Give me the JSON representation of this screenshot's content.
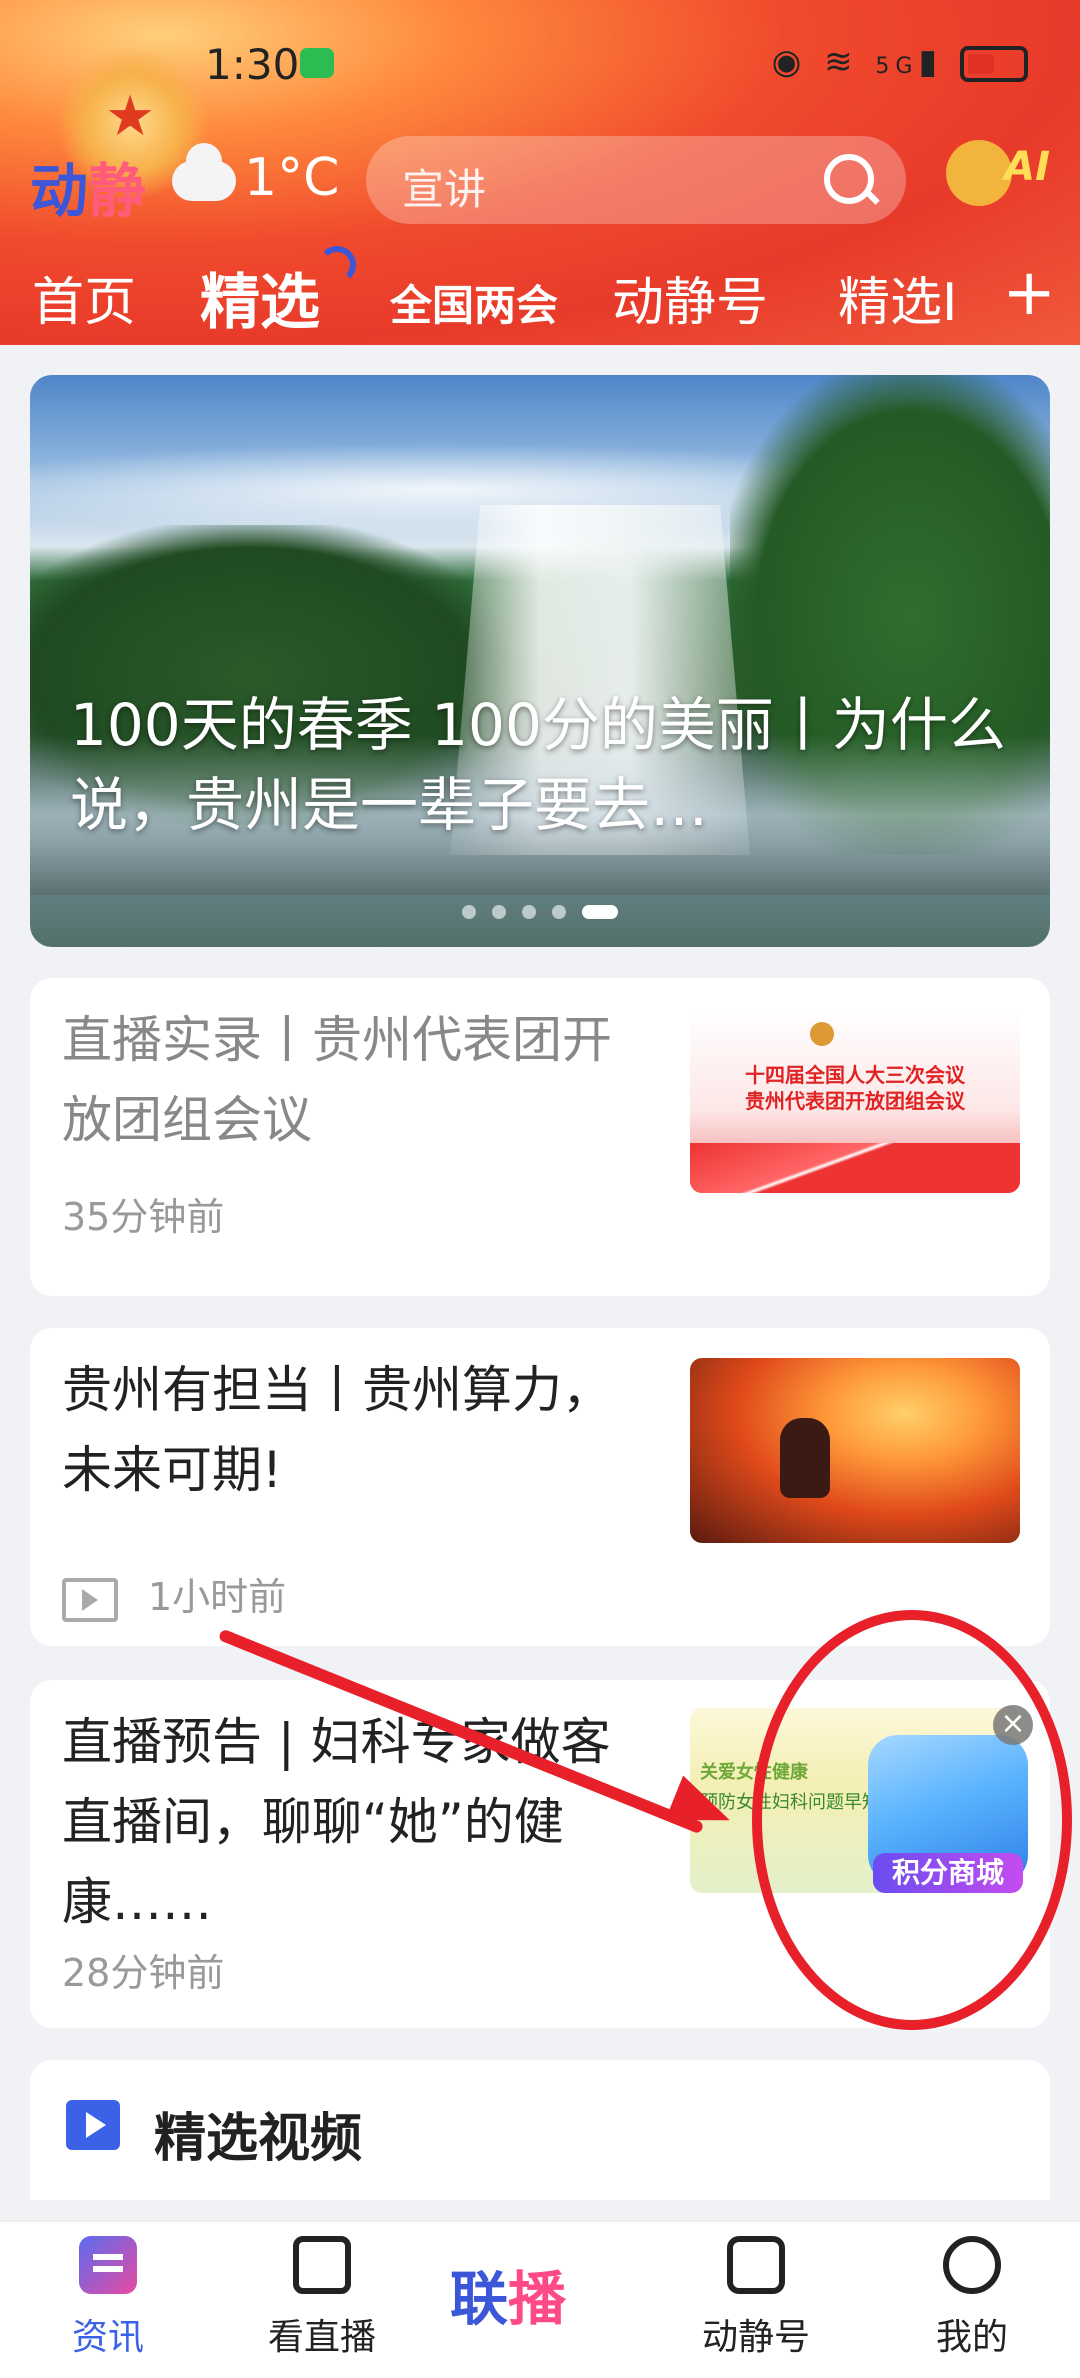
{
  "status": {
    "time": "1:30",
    "network": "5G"
  },
  "brand": {
    "logo_a": "动",
    "logo_b": "静"
  },
  "weather": {
    "temp": "1°C"
  },
  "search": {
    "placeholder": "宣讲"
  },
  "mascot": {
    "label": "AI"
  },
  "tabs": [
    {
      "label": "首页"
    },
    {
      "label": "精选"
    },
    {
      "label": "全国两会"
    },
    {
      "label": "动静号"
    },
    {
      "label": "精选I"
    }
  ],
  "hero": {
    "title": "100天的春季 100分的美丽丨为什么说，贵州是一辈子要去…"
  },
  "articles": [
    {
      "title": "直播实录丨贵州代表团开放团组会议",
      "time": "35分钟前",
      "thumb_text": "十四届全国人大三次会议\n贵州代表团开放团组会议"
    },
    {
      "title": "贵州有担当丨贵州算力，未来可期!",
      "time": "1小时前"
    },
    {
      "title": "直播预告 | 妇科专家做客直播间，聊聊“她”的健康……",
      "time": "28分钟前",
      "thumb_text1": "关爱女性健康",
      "thumb_text2": "预防女性妇科问题早知道"
    }
  ],
  "floating_badge": {
    "label": "积分商城",
    "close": "×"
  },
  "section": {
    "title": "精选视频"
  },
  "nav": {
    "news": "资讯",
    "watch_live": "看直播",
    "center_a": "联",
    "center_b": "播",
    "djh": "动静号",
    "me": "我的"
  },
  "colors": {
    "accent": "#3b62e6",
    "header_red": "#e83a2a",
    "annotation_red": "#e8202a"
  }
}
